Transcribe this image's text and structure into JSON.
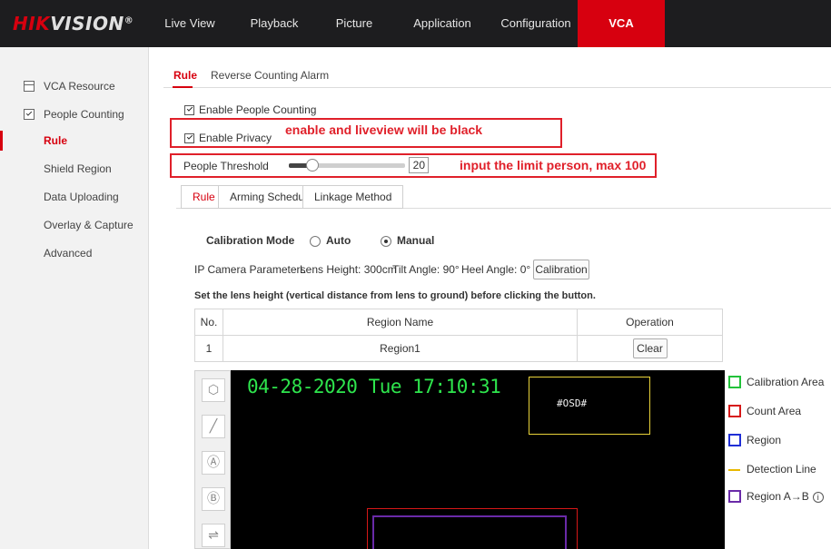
{
  "brand": {
    "logo_red": "HIK",
    "logo_rest": "VISION",
    "mark": "®"
  },
  "topnav": {
    "items": [
      {
        "label": "Live View"
      },
      {
        "label": "Playback"
      },
      {
        "label": "Picture"
      },
      {
        "label": "Application"
      },
      {
        "label": "Configuration"
      },
      {
        "label": "VCA",
        "active": true
      }
    ]
  },
  "sidebar": {
    "vca_resource": "VCA Resource",
    "people_counting": "People Counting",
    "items": [
      {
        "label": "Rule",
        "active": true
      },
      {
        "label": "Shield Region"
      },
      {
        "label": "Data Uploading"
      },
      {
        "label": "Overlay & Capture"
      },
      {
        "label": "Advanced"
      }
    ]
  },
  "main_tabs": [
    {
      "label": "Rule",
      "active": true
    },
    {
      "label": "Reverse Counting Alarm"
    }
  ],
  "settings": {
    "enable_people_counting": {
      "label": "Enable People Counting",
      "checked": true
    },
    "enable_privacy": {
      "label": "Enable Privacy",
      "checked": true
    },
    "people_threshold": {
      "label": "People Threshold",
      "value": "20",
      "slider_fraction": 0.2
    }
  },
  "annotations": {
    "privacy_note": "enable and liveview will be black",
    "threshold_note": "input the limit person, max 100"
  },
  "sub_tabs": [
    {
      "label": "Rule",
      "active": true
    },
    {
      "label": "Arming Schedule"
    },
    {
      "label": "Linkage Method"
    }
  ],
  "calibration": {
    "mode_label": "Calibration Mode",
    "auto_label": "Auto",
    "manual_label": "Manual",
    "selected": "Manual",
    "params_label": "IP Camera Parameters",
    "lens_height": "Lens Height:  300cm",
    "tilt_angle": "Tilt Angle:  90°",
    "heel_angle": "Heel Angle:  0°",
    "button_label": "Calibration",
    "hint": "Set the lens height (vertical distance from lens to ground) before clicking the button."
  },
  "region_table": {
    "headers": [
      "No.",
      "Region Name",
      "Operation"
    ],
    "rows": [
      {
        "no": "1",
        "name": "Region1",
        "action": "Clear"
      }
    ]
  },
  "video": {
    "timestamp": "04-28-2020 Tue 17:10:31",
    "osd_label": "#OSD#"
  },
  "tools": [
    "hexagon-icon",
    "line-icon",
    "region-a-icon",
    "region-b-icon",
    "swap-icon"
  ],
  "legend": [
    {
      "label": "Calibration Area",
      "color": "#22c23a",
      "shape": "square"
    },
    {
      "label": "Count Area",
      "color": "#d61818",
      "shape": "square"
    },
    {
      "label": "Region",
      "color": "#1f2ed6",
      "shape": "square"
    },
    {
      "label": "Detection Line",
      "color": "#e8b800",
      "shape": "line"
    },
    {
      "label": "Region A→B",
      "color": "#6a2aa8",
      "shape": "square"
    }
  ],
  "colors": {
    "accent": "#d7000f",
    "annotation": "#e0202a",
    "nav_bg": "#1d1d1f"
  }
}
